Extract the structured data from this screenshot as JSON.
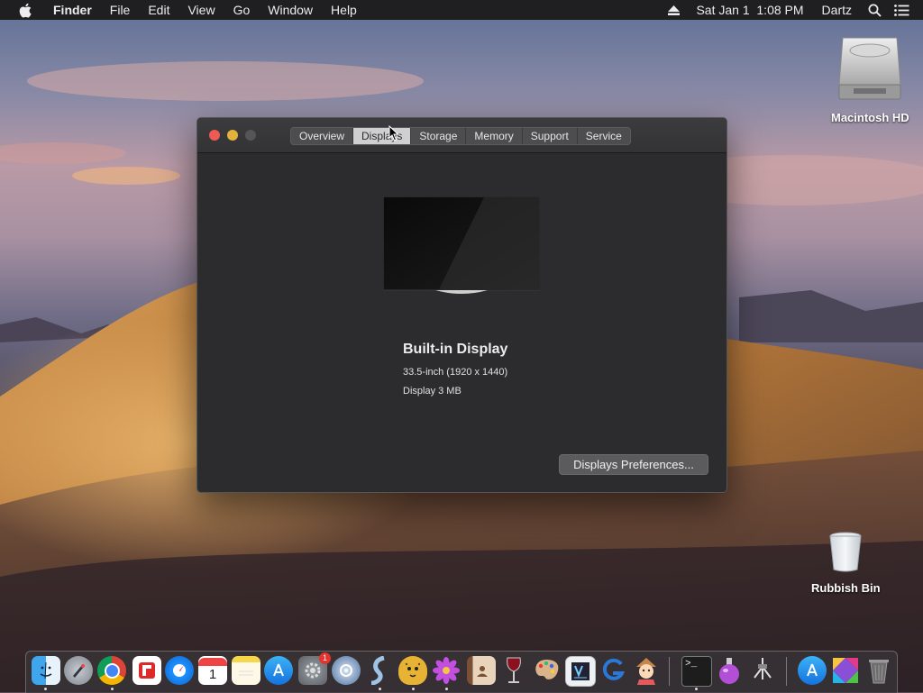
{
  "menubar": {
    "app": "Finder",
    "items": [
      "File",
      "Edit",
      "View",
      "Go",
      "Window",
      "Help"
    ],
    "datetime": "Sat Jan 1  1:08 PM",
    "user": "Dartz"
  },
  "desktop": {
    "hd_label": "Macintosh HD",
    "bin_label": "Rubbish Bin"
  },
  "window": {
    "tabs": [
      "Overview",
      "Displays",
      "Storage",
      "Memory",
      "Support",
      "Service"
    ],
    "active_tab": "Displays",
    "display_name": "Built-in Display",
    "display_size": "33.5-inch (1920 x 1440)",
    "display_memory": "Display 3 MB",
    "prefs_button": "Displays Preferences..."
  },
  "dock": {
    "apps": [
      "finder-icon",
      "launchpad-icon",
      "chrome-icon",
      "flipboard-icon",
      "safari-icon",
      "calendar-icon",
      "notes-icon",
      "app-store-icon",
      "system-preferences-icon",
      "network-utility-icon",
      "scrivener-icon",
      "cheetah-icon",
      "flower-icon",
      "contacts-icon",
      "wine-icon",
      "paint-icon",
      "code-editor-icon",
      "gitkraken-icon",
      "character-icon",
      "terminal-icon",
      "potion-icon",
      "claw-icon",
      "app-store-icon-2",
      "multicolor-icon",
      "trash-icon"
    ],
    "badge": "1"
  }
}
